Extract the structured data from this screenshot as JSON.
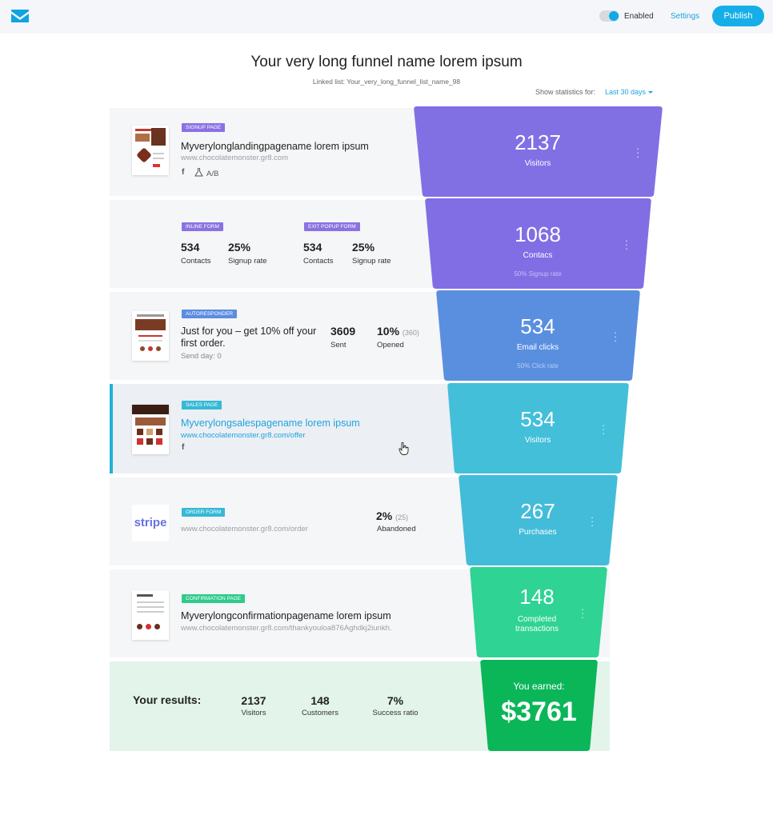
{
  "header": {
    "toggle_label": "Enabled",
    "settings_label": "Settings",
    "publish_label": "Publish"
  },
  "page": {
    "title": "Your very long funnel name lorem ipsum",
    "linked_list": "Linked list: Your_very_long_funnel_list_name_98",
    "stats_label": "Show statistics for:",
    "stats_value": "Last 30 days"
  },
  "rows": {
    "signup": {
      "badge": "SIGNUP PAGE",
      "name": "Myverylonglandingpagename lorem ipsum",
      "url": "www.chocolatemonster.gr8.com",
      "ab_label": "A/B",
      "facebook_glyph": "f"
    },
    "forms": {
      "inline": {
        "badge": "INLINE FORM",
        "contacts": "534",
        "contacts_label": "Contacts",
        "rate": "25%",
        "rate_label": "Signup rate"
      },
      "exit": {
        "badge": "EXIT POPUP FORM",
        "contacts": "534",
        "contacts_label": "Contacts",
        "rate": "25%",
        "rate_label": "Signup rate"
      }
    },
    "autoresponder": {
      "badge": "AUTORESPONDER",
      "subject": "Just for you – get 10% off your first order.",
      "send_day": "Send day: 0",
      "sent": "3609",
      "sent_label": "Sent",
      "opened": "10%",
      "opened_count": "(360)",
      "opened_label": "Opened"
    },
    "sales": {
      "badge": "SALES PAGE",
      "name": "Myverylongsalespagename lorem ipsum",
      "url": "www.chocolatemonster.gr8.com/offer",
      "facebook_glyph": "f"
    },
    "order": {
      "logo": "stripe",
      "badge": "ORDER FORM",
      "url": "www.chocolatemonster.gr8.com/order",
      "abandoned": "2%",
      "abandoned_count": "(25)",
      "abandoned_label": "Abandoned"
    },
    "confirmation": {
      "badge": "CONFIRMATION PAGE",
      "name": "Myverylongconfirmationpagename lorem ipsum",
      "url": "www.chocolatemonster.gr8.com/thankyouloa876Aghdkj2iunkh."
    },
    "results": {
      "title": "Your results:",
      "visitors": "2137",
      "visitors_label": "Visitors",
      "customers": "148",
      "customers_label": "Customers",
      "ratio": "7%",
      "ratio_label": "Success ratio"
    }
  },
  "funnel": {
    "stages": [
      {
        "value": "2137",
        "label": "Visitors",
        "sub": "",
        "color": "#8170e4"
      },
      {
        "value": "1068",
        "label": "Contacs",
        "sub": "50% Signup rate",
        "color": "#816ee4"
      },
      {
        "value": "534",
        "label": "Email clicks",
        "sub": "50% Click rate",
        "color": "#5a8fe0"
      },
      {
        "value": "534",
        "label": "Visitors",
        "sub": "",
        "color": "#43bfd9"
      },
      {
        "value": "267",
        "label": "Purchases",
        "sub": "",
        "color": "#43bcd9"
      },
      {
        "value": "148",
        "label": "Completed transactions",
        "sub": "",
        "color": "#2fd394"
      }
    ],
    "earned_label": "You earned:",
    "earned_value": "$3761",
    "earned_color": "#0bb659"
  },
  "icons": {
    "logo": "envelope-logo-icon",
    "ab_test": "flask-icon",
    "facebook": "facebook-icon",
    "menu": "kebab-menu-icon",
    "cursor": "hand-pointer-icon"
  }
}
